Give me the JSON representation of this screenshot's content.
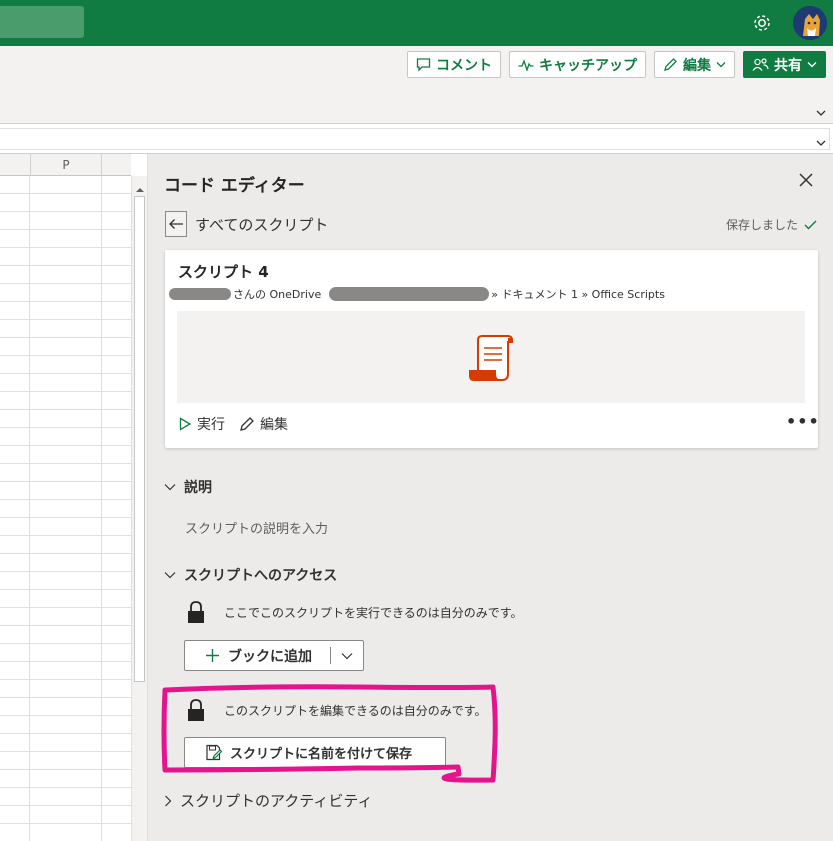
{
  "topbar": {
    "brand_color": "#107c41",
    "icons": [
      "settings-gear-icon",
      "user-avatar"
    ]
  },
  "ribbon": {
    "comment_label": "コメント",
    "catchup_label": "キャッチアップ",
    "edit_label": "編集",
    "share_label": "共有"
  },
  "grid": {
    "column_label": "P"
  },
  "editor": {
    "title": "コード エディター",
    "back_label": "すべてのスクリプト",
    "saved_status": "保存しました",
    "script": {
      "name": "スクリプト 4",
      "owner_suffix": "さんの OneDrive",
      "path_tail": "» ドキュメント 1 » Office Scripts",
      "run_label": "実行",
      "edit_label": "編集",
      "more_label": "•••"
    },
    "description": {
      "header": "説明",
      "placeholder": "スクリプトの説明を入力"
    },
    "access": {
      "header": "スクリプトへのアクセス",
      "run_notice": "ここでこのスクリプトを実行できるのは自分のみです。",
      "add_to_book_label": "ブックに追加",
      "edit_notice": "このスクリプトを編集できるのは自分のみです。",
      "save_as_label": "スクリプトに名前を付けて保存"
    },
    "activity": {
      "header": "スクリプトのアクティビティ"
    }
  },
  "colors": {
    "accent": "#107c41",
    "highlight": "#e3148c",
    "office_script_icon": "#d83b01"
  }
}
